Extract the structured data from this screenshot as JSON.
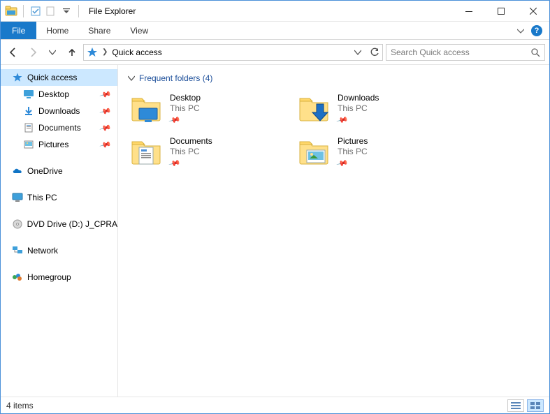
{
  "title": "File Explorer",
  "ribbon": {
    "file": "File",
    "home": "Home",
    "share": "Share",
    "view": "View"
  },
  "nav": {
    "address_icon_label": "Quick access",
    "crumb": "Quick access",
    "search_placeholder": "Search Quick access"
  },
  "sidebar": {
    "quick_access": "Quick access",
    "items": [
      {
        "label": "Desktop"
      },
      {
        "label": "Downloads"
      },
      {
        "label": "Documents"
      },
      {
        "label": "Pictures"
      }
    ],
    "onedrive": "OneDrive",
    "this_pc": "This PC",
    "dvd": "DVD Drive (D:) J_CPRA",
    "network": "Network",
    "homegroup": "Homegroup"
  },
  "group": {
    "header": "Frequent folders (4)"
  },
  "tiles": [
    {
      "name": "Desktop",
      "sub": "This PC"
    },
    {
      "name": "Downloads",
      "sub": "This PC"
    },
    {
      "name": "Documents",
      "sub": "This PC"
    },
    {
      "name": "Pictures",
      "sub": "This PC"
    }
  ],
  "status": {
    "count": "4 items"
  }
}
